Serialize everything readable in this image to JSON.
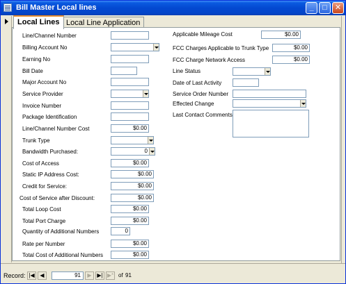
{
  "window": {
    "title": "Bill Master Local lines",
    "controls": {
      "minimize": "_",
      "maximize": "□",
      "close": "✕"
    }
  },
  "tabs": [
    {
      "label": "Local Lines",
      "active": true
    },
    {
      "label": "Local Line Application",
      "active": false
    }
  ],
  "left_fields": [
    {
      "label": "Line/Channel Number",
      "value": "",
      "dropdown": false
    },
    {
      "label": "Billing Account No",
      "value": "",
      "dropdown": true
    },
    {
      "label": "Earning No",
      "value": "",
      "dropdown": false
    },
    {
      "label": "Bill Date",
      "value": "",
      "dropdown": false
    },
    {
      "label": "Major Account No",
      "value": "",
      "dropdown": false
    },
    {
      "label": "Service Provider",
      "value": "",
      "dropdown": true
    },
    {
      "label": "Invoice Number",
      "value": "",
      "dropdown": false
    },
    {
      "label": "Package Identification",
      "value": "",
      "dropdown": false
    },
    {
      "label": "Line/Channel Number Cost",
      "value": "$0.00",
      "dropdown": false
    },
    {
      "label": "Trunk Type",
      "value": "",
      "dropdown": true
    },
    {
      "label": "Bandwidth Purchased:",
      "value": "0",
      "dropdown": true
    },
    {
      "label": "Cost of Access",
      "value": "$0.00",
      "dropdown": false
    },
    {
      "label": "Static IP Address Cost:",
      "value": "$0.00",
      "dropdown": false
    },
    {
      "label": "Credit for Service:",
      "value": "$0.00",
      "dropdown": false
    },
    {
      "label": "Cost of Service after Discount:",
      "value": "$0.00",
      "dropdown": false
    },
    {
      "label": "Total Loop Cost",
      "value": "$0.00",
      "dropdown": false
    },
    {
      "label": "Total Port Charge",
      "value": "$0.00",
      "dropdown": false
    },
    {
      "label": "Quantity of Additional Numbers",
      "value": "0",
      "dropdown": false
    },
    {
      "label": "Rate per Number",
      "value": "$0.00",
      "dropdown": false
    },
    {
      "label": "Total Cost of Additional Numbers",
      "value": "$0.00",
      "dropdown": false
    }
  ],
  "right_fields": {
    "applicable_mileage_cost": {
      "label": "Applicable Mileage Cost",
      "value": "$0.00"
    },
    "fcc_trunk": {
      "label": "FCC Charges Applicable to Trunk Type",
      "value": "$0.00"
    },
    "fcc_network": {
      "label": "FCC Charge Network Access",
      "value": "$0.00"
    },
    "line_status": {
      "label": "Line Status",
      "value": ""
    },
    "date_last_activity": {
      "label": "Date of Last Activity",
      "value": ""
    },
    "service_order_number": {
      "label": "Service Order Number",
      "value": ""
    },
    "effected_change": {
      "label": "Effected Change",
      "value": ""
    },
    "last_contact_comments": {
      "label": "Last Contact Comments",
      "value": ""
    }
  },
  "navigator": {
    "label": "Record:",
    "first": "|◀",
    "prev": "◀",
    "current": "91",
    "next": "▶",
    "last": "▶|",
    "new": "▶*",
    "of": "of",
    "total": "91"
  }
}
